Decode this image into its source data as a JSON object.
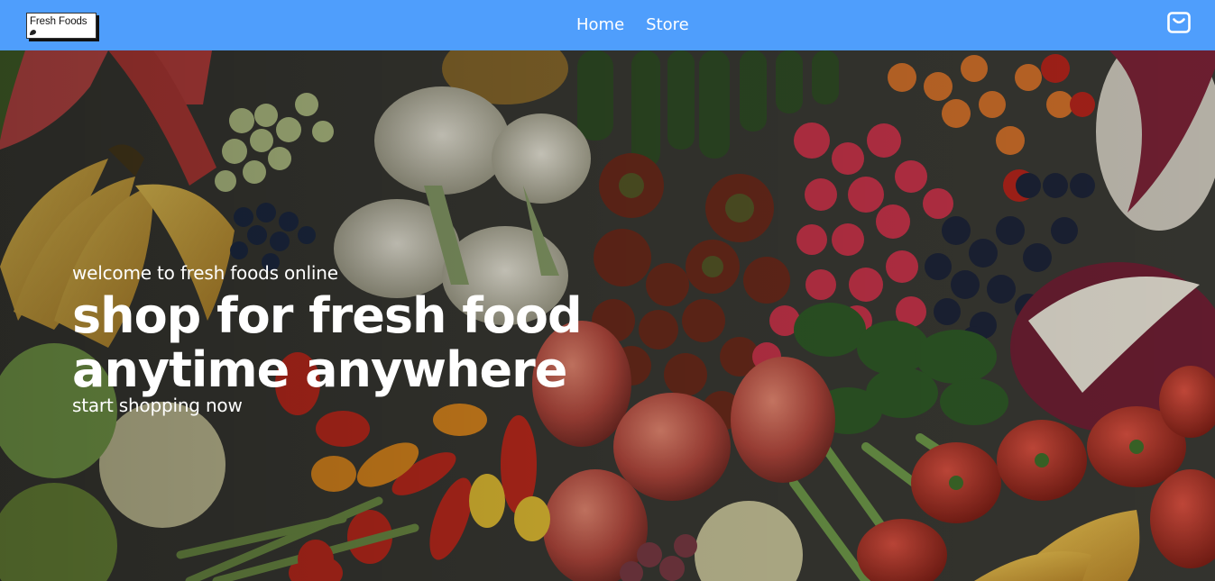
{
  "navbar": {
    "logo_text": "Fresh Foods",
    "links": [
      {
        "label": "Home"
      },
      {
        "label": "Store"
      }
    ],
    "cart_icon": "shopping-bag-icon",
    "background": "#4f9efc"
  },
  "hero": {
    "welcome": "welcome to fresh foods online",
    "headline_line1": "shop for fresh food",
    "headline_line2": "anytime anywhere",
    "cta": "start shopping now",
    "background_image": "assorted fresh fruits and vegetables"
  }
}
